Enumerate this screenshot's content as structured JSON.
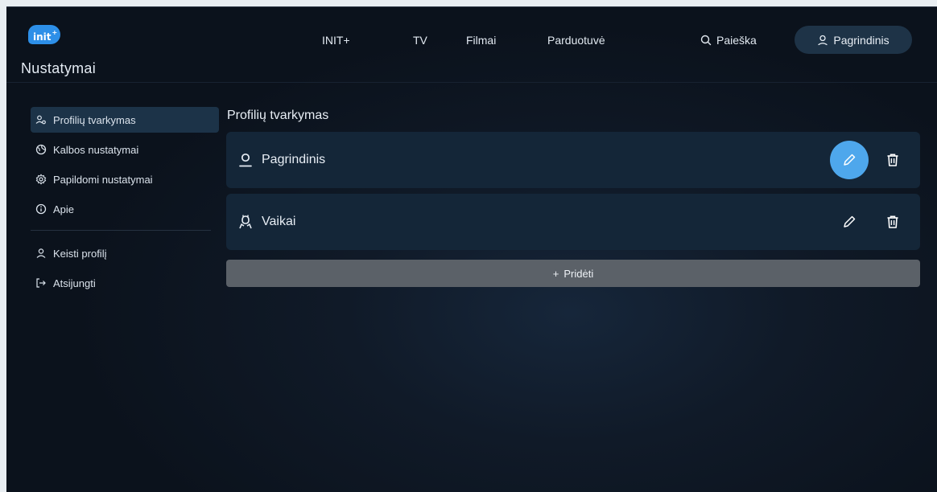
{
  "header": {
    "logo_text": "init",
    "logo_plus": "+",
    "page_title": "Nustatymai",
    "nav": [
      {
        "label": "INIT+"
      },
      {
        "label": "TV"
      },
      {
        "label": "Filmai"
      },
      {
        "label": "Parduotuvė"
      }
    ],
    "search_label": "Paieška",
    "profile_label": "Pagrindinis"
  },
  "sidebar": {
    "items": [
      {
        "label": "Profilių tvarkymas",
        "icon": "profiles-icon",
        "active": true
      },
      {
        "label": "Kalbos nustatymai",
        "icon": "language-icon"
      },
      {
        "label": "Papildomi nustatymai",
        "icon": "gear-icon"
      },
      {
        "label": "Apie",
        "icon": "info-icon"
      }
    ],
    "account_items": [
      {
        "label": "Keisti profilį",
        "icon": "user-icon"
      },
      {
        "label": "Atsijungti",
        "icon": "logout-icon"
      }
    ]
  },
  "main": {
    "section_title": "Profilių tvarkymas",
    "profiles": [
      {
        "name": "Pagrindinis",
        "icon": "user-icon",
        "focused": true
      },
      {
        "name": "Vaikai",
        "icon": "kid-user-icon",
        "focused": false
      }
    ],
    "add_label": "Pridėti",
    "add_symbol": "+"
  },
  "colors": {
    "background": "#0d1622",
    "row": "#142638",
    "accent": "#4ea7ec",
    "add_button": "#5b6168",
    "logo": "#2d8fe8"
  }
}
